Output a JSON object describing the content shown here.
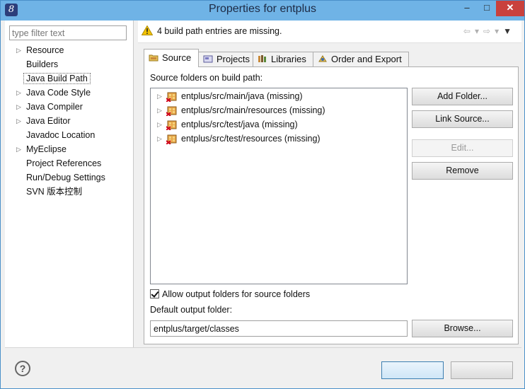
{
  "window": {
    "title": "Properties for entplus",
    "app_icon_glyph": "8"
  },
  "filter": {
    "placeholder": "type filter text",
    "value": ""
  },
  "nav": [
    {
      "label": "Resource",
      "expandable": true
    },
    {
      "label": "Builders",
      "expandable": false
    },
    {
      "label": "Java Build Path",
      "expandable": false,
      "selected": true
    },
    {
      "label": "Java Code Style",
      "expandable": true
    },
    {
      "label": "Java Compiler",
      "expandable": true
    },
    {
      "label": "Java Editor",
      "expandable": true
    },
    {
      "label": "Javadoc Location",
      "expandable": false
    },
    {
      "label": "MyEclipse",
      "expandable": true
    },
    {
      "label": "Project References",
      "expandable": false
    },
    {
      "label": "Run/Debug Settings",
      "expandable": false
    },
    {
      "label": "SVN 版本控制",
      "expandable": false
    }
  ],
  "message": "4 build path entries are missing.",
  "tabs": [
    {
      "label": "Source",
      "icon": "source-folder-icon",
      "active": true
    },
    {
      "label": "Projects",
      "icon": "projects-icon"
    },
    {
      "label": "Libraries",
      "icon": "libraries-icon"
    },
    {
      "label": "Order and Export",
      "icon": "order-export-icon"
    }
  ],
  "source": {
    "section_label": "Source folders on build path:",
    "entries": [
      "entplus/src/main/java (missing)",
      "entplus/src/main/resources (missing)",
      "entplus/src/test/java (missing)",
      "entplus/src/test/resources (missing)"
    ],
    "buttons": {
      "add_folder": "Add Folder...",
      "link_source": "Link Source...",
      "edit": "Edit...",
      "remove": "Remove"
    },
    "allow_output_label": "Allow output folders for source folders",
    "allow_output_checked": true,
    "default_output_label": "Default output folder:",
    "default_output_value": "entplus/target/classes",
    "browse": "Browse..."
  },
  "colors": {
    "titlebar": "#6fb3e6",
    "close": "#c9413d",
    "warning": "#f2c200"
  }
}
